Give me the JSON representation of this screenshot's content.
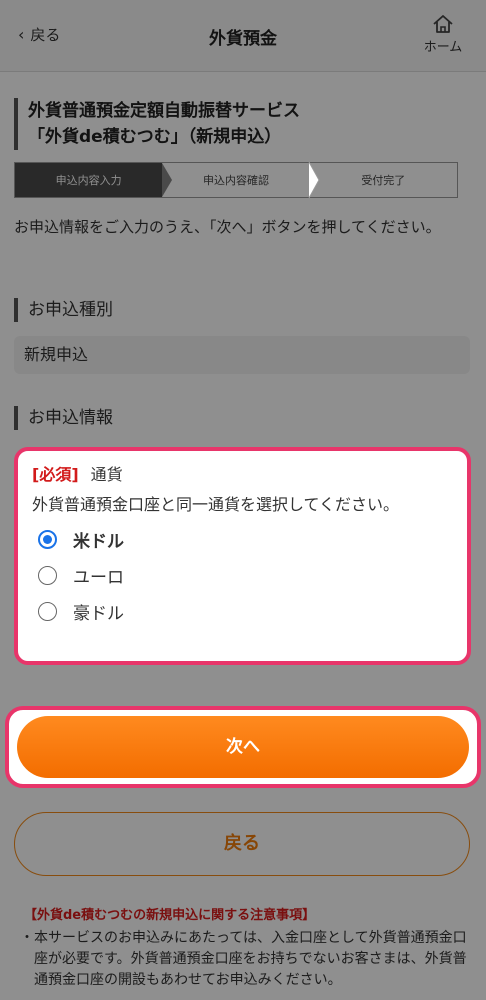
{
  "header": {
    "back_label": "戻る",
    "title": "外貨預金",
    "home_label": "ホーム"
  },
  "service": {
    "title_line1": "外貨普通預金定額自動振替サービス",
    "title_line2": "「外貨de積むつむ」（新規申込）"
  },
  "steps": [
    {
      "label": "申込内容入力",
      "active": true
    },
    {
      "label": "申込内容確認",
      "active": false
    },
    {
      "label": "受付完了",
      "active": false
    }
  ],
  "instruction": "お申込情報をご入力のうえ、「次へ」ボタンを押してください。",
  "application_type": {
    "heading": "お申込種別",
    "value": "新規申込"
  },
  "application_info": {
    "heading": "お申込情報",
    "required_tag": "[必須]",
    "field_label": "通貨",
    "note": "外貨普通預金口座と同一通貨を選択してください。",
    "options": [
      {
        "label": "米ドル",
        "selected": true
      },
      {
        "label": "ユーロ",
        "selected": false
      },
      {
        "label": "豪ドル",
        "selected": false
      }
    ]
  },
  "buttons": {
    "next_label": "次へ",
    "back_label": "戻る"
  },
  "notice": {
    "heading": "【外貨de積むつむの新規申込に関する注意事項】",
    "text": "・本サービスのお申込みにあたっては、入金口座として外貨普通預金口座が必要です。外貨普通預金口座をお持ちでないお客さまは、外貨普通預金口座の開設もあわせてお申込みください。"
  },
  "colors": {
    "accent_orange": "#f36d00",
    "highlight_pink": "#e8356a",
    "required_red": "#d21b1b",
    "radio_blue": "#1a73e8"
  }
}
